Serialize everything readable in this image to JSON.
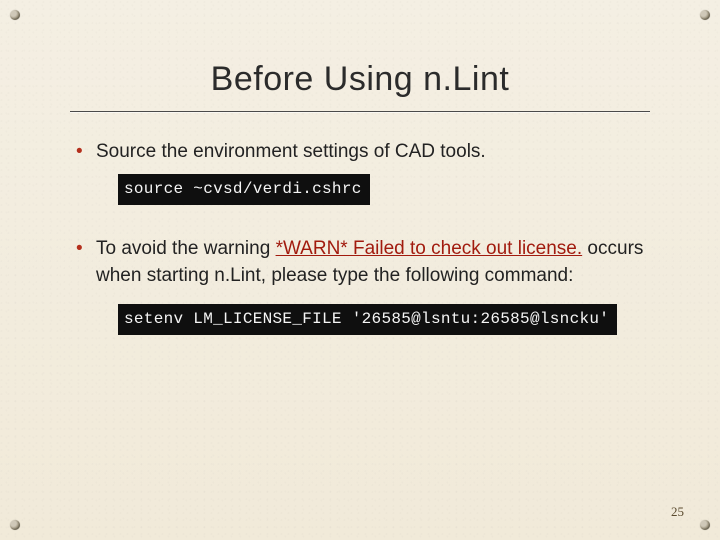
{
  "title": "Before Using n.Lint",
  "bullets": [
    {
      "text_before": "Source the environment settings of CAD tools.",
      "code": "source ~cvsd/verdi.cshrc"
    },
    {
      "text_before": "To avoid the warning ",
      "warn_text": "*WARN* Failed to check out license.",
      "text_after": " occurs when starting n.Lint, please type the following command:",
      "code": "setenv LM_LICENSE_FILE '26585@lsntu:26585@lsncku'"
    }
  ],
  "page_number": "25"
}
